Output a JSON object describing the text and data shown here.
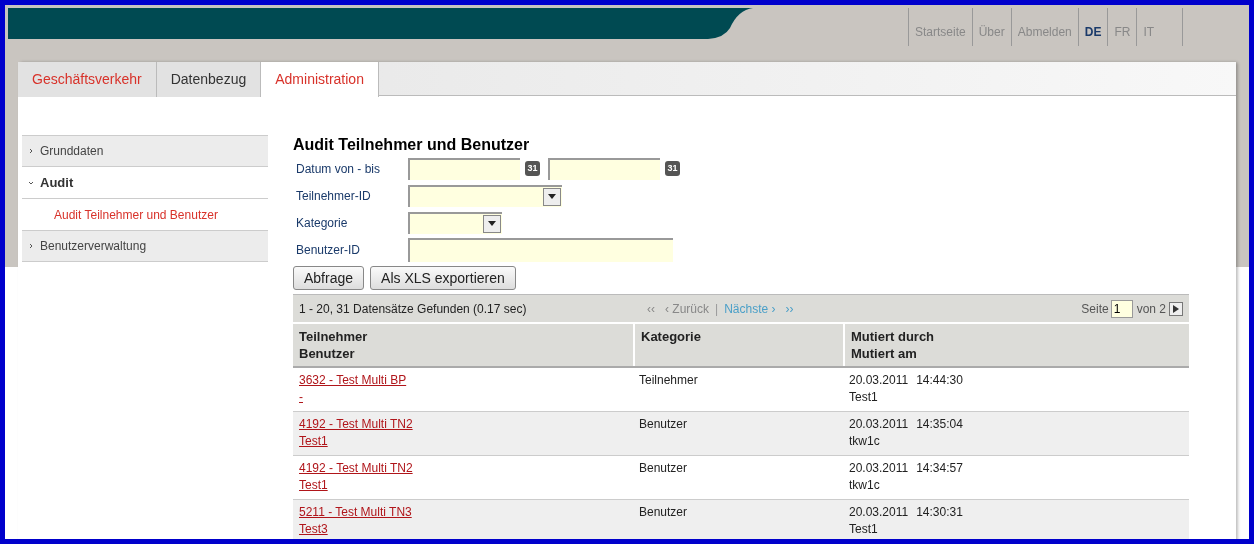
{
  "top_links": [
    {
      "label": "Startseite",
      "selected": false
    },
    {
      "label": "Über",
      "selected": false
    },
    {
      "label": "Abmelden",
      "selected": false
    },
    {
      "label": "DE",
      "selected": true
    },
    {
      "label": "FR",
      "selected": false
    },
    {
      "label": "IT",
      "selected": false
    }
  ],
  "tabs": [
    {
      "label": "Geschäftsverkehr",
      "selected": false,
      "accent": true
    },
    {
      "label": "Datenbezug",
      "selected": false,
      "accent": false
    },
    {
      "label": "Administration",
      "selected": true,
      "accent": true
    }
  ],
  "sidebar": {
    "items": [
      {
        "label": "Grunddaten",
        "expanded": false
      },
      {
        "label": "Audit",
        "expanded": true,
        "children": [
          {
            "label": "Audit Teilnehmer und Benutzer",
            "selected": true
          }
        ]
      },
      {
        "label": "Benutzerverwaltung",
        "expanded": false
      }
    ]
  },
  "form": {
    "title": "Audit Teilnehmer und Benutzer",
    "fields": [
      {
        "kind": "date_range",
        "label": "Datum von - bis",
        "calendar_icons": [
          "31",
          "31"
        ]
      },
      {
        "kind": "select",
        "label": "Teilnehmer-ID"
      },
      {
        "kind": "short_select",
        "label": "Kategorie"
      },
      {
        "kind": "text",
        "label": "Benutzer-ID"
      }
    ],
    "buttons": [
      "Abfrage",
      "Als XLS exportieren"
    ]
  },
  "results": {
    "summary": "1 - 20, 31 Datensätze Gefunden (0.17 sec)",
    "pager": [
      {
        "label": "‹‹",
        "disabled": true
      },
      {
        "label": "‹ Zurück",
        "disabled": true
      },
      {
        "label": "|",
        "kind": "separator"
      },
      {
        "label": "Nächste ›",
        "disabled": false
      },
      {
        "label": "››",
        "disabled": false
      }
    ],
    "page_label": "Seite",
    "page_value": "1",
    "page_total": "von 2",
    "columns": [
      {
        "lines": [
          "Teilnehmer",
          "Benutzer"
        ]
      },
      {
        "lines": [
          "Kategorie"
        ]
      },
      {
        "lines": [
          "Mutiert durch",
          "Mutiert am"
        ]
      }
    ],
    "rows": [
      {
        "participant": "3632 - Test Multi BP",
        "user": "-",
        "category": "Teilnehmer",
        "date": "20.03.2011",
        "time": "14:44:30",
        "by": "Test1"
      },
      {
        "participant": "4192 - Test Multi TN2",
        "user": "Test1",
        "category": "Benutzer",
        "date": "20.03.2011",
        "time": "14:35:04",
        "by": "tkw1c"
      },
      {
        "participant": "4192 - Test Multi TN2",
        "user": "Test1",
        "category": "Benutzer",
        "date": "20.03.2011",
        "time": "14:34:57",
        "by": "tkw1c"
      },
      {
        "participant": "5211 - Test Multi TN3",
        "user": "Test3",
        "category": "Benutzer",
        "date": "20.03.2011",
        "time": "14:30:31",
        "by": "Test1"
      }
    ]
  }
}
